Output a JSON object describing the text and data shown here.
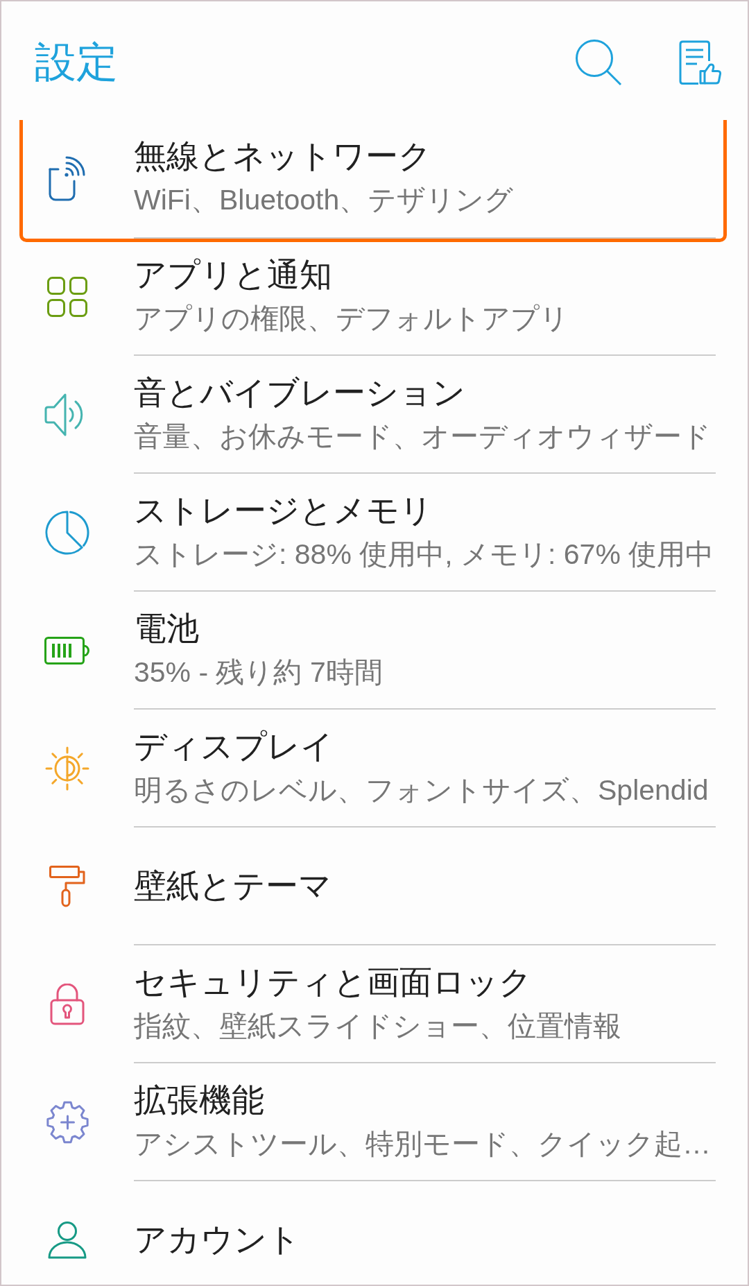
{
  "header": {
    "title": "設定"
  },
  "items": [
    {
      "title": "無線とネットワーク",
      "subtitle": "WiFi、Bluetooth、テザリング",
      "selected": true
    },
    {
      "title": "アプリと通知",
      "subtitle": "アプリの権限、デフォルトアプリ",
      "selected": false
    },
    {
      "title": "音とバイブレーション",
      "subtitle": "音量、お休みモード、オーディオウィザード",
      "selected": false
    },
    {
      "title": "ストレージとメモリ",
      "subtitle": "ストレージ: 88% 使用中, メモリ: 67% 使用中",
      "selected": false
    },
    {
      "title": "電池",
      "subtitle": "35% - 残り約 7時間",
      "selected": false
    },
    {
      "title": "ディスプレイ",
      "subtitle": "明るさのレベル、フォントサイズ、Splendid",
      "selected": false
    },
    {
      "title": "壁紙とテーマ",
      "selected": false
    },
    {
      "title": "セキュリティと画面ロック",
      "subtitle": "指紋、壁紙スライドショー、位置情報",
      "selected": false
    },
    {
      "title": "拡張機能",
      "subtitle": "アシストツール、特別モード、クイック起…",
      "selected": false
    },
    {
      "title": "アカウント",
      "selected": false
    }
  ]
}
